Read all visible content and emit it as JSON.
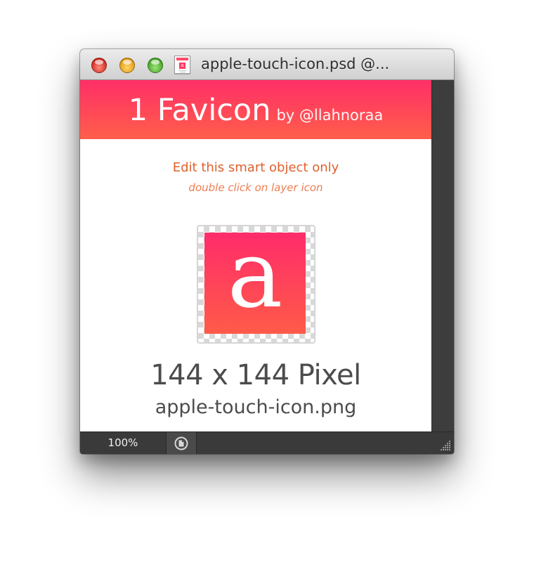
{
  "window": {
    "title": "apple-touch-icon.psd @..."
  },
  "canvas": {
    "banner_title": "1 Favicon",
    "banner_byline": "by @llahnoraa",
    "instruction": "Edit this smart object only",
    "instruction_sub": "double click on layer icon",
    "icon_letter": "a",
    "pixel_size": "144 x 144 Pixel",
    "filename": "apple-touch-icon.png"
  },
  "statusbar": {
    "zoom": "100%"
  },
  "icons": {
    "close": "close-button",
    "minimize": "minimize-button",
    "zoom": "zoom-button",
    "document": "psd-document-icon",
    "status": "document-status-icon",
    "resize": "resize-grip-icon"
  },
  "colors": {
    "accent_top": "#ff2f67",
    "accent_bottom": "#ff5e4a",
    "instruction_text": "#e0602c",
    "chrome_dark": "#3a3a3a"
  }
}
